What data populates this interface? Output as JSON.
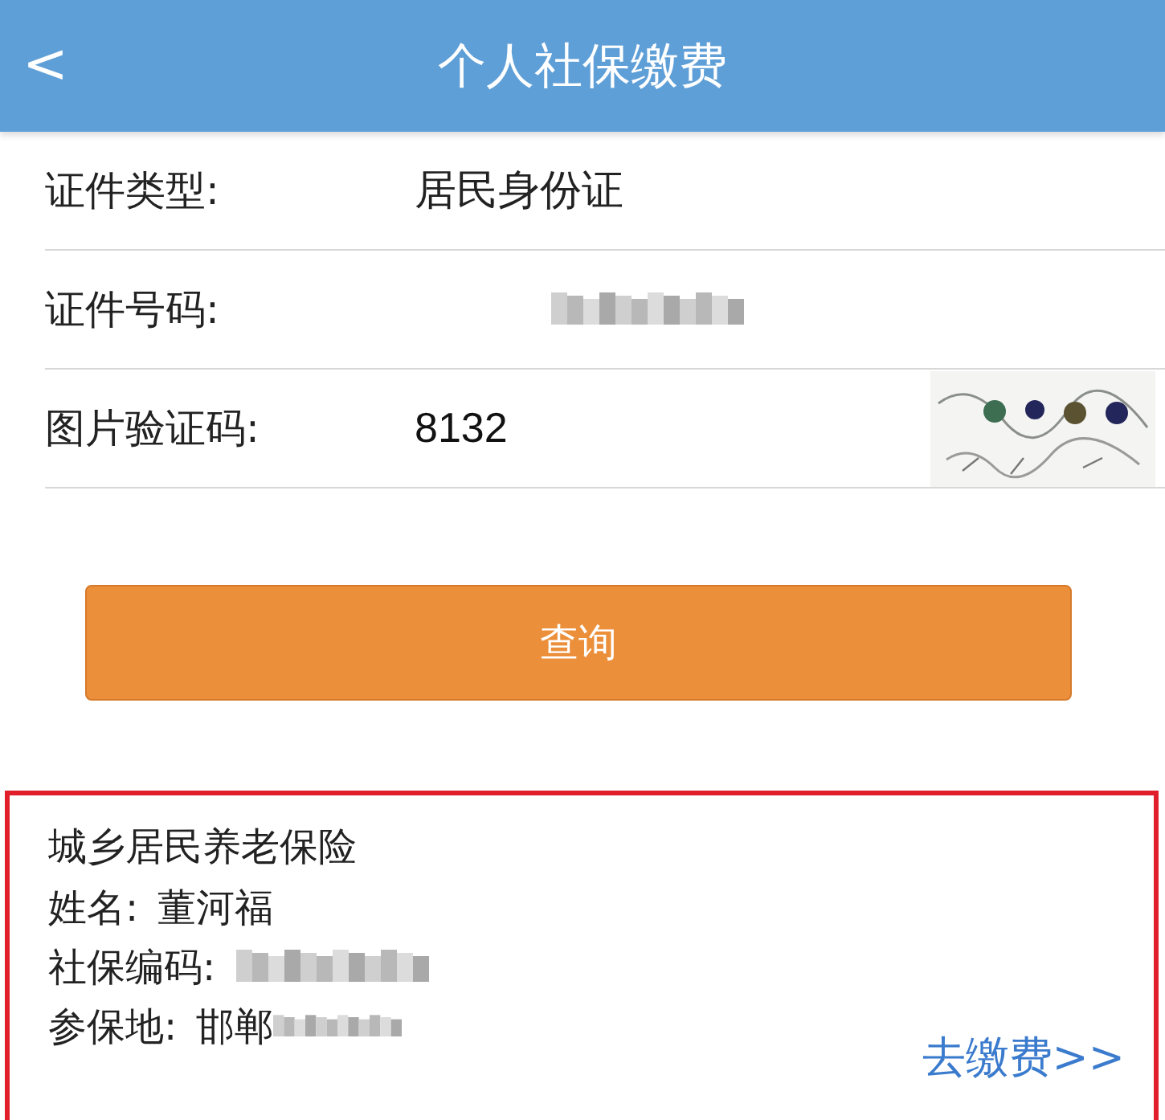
{
  "header": {
    "back": "<",
    "title": "个人社保缴费"
  },
  "form": {
    "rows": [
      {
        "kind": "text",
        "label": "证件类型:",
        "value": "居民身份证"
      },
      {
        "kind": "blurred",
        "label": "证件号码:"
      },
      {
        "kind": "captcha",
        "label": "图片验证码:",
        "value": "8132"
      }
    ]
  },
  "query_button": "查询",
  "result": {
    "title": "城乡居民养老保险",
    "lines": [
      {
        "kind": "text",
        "label": "姓名:",
        "value": "董河福"
      },
      {
        "kind": "blurred",
        "label": "社保编码:"
      },
      {
        "kind": "partial",
        "label": "参保地:",
        "value": "邯郸"
      }
    ],
    "pay_link": "去缴费>>"
  }
}
